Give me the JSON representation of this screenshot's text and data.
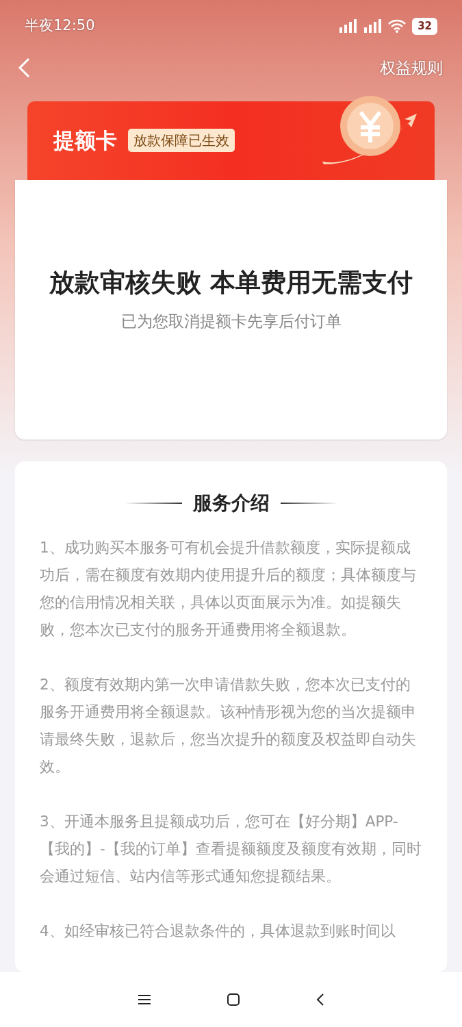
{
  "status_bar": {
    "time": "半夜12:50",
    "battery": "32"
  },
  "header": {
    "rules_link": "权益规则"
  },
  "banner": {
    "title": "提额卡",
    "badge": "放款保障已生效"
  },
  "result": {
    "title": "放款审核失败 本单费用无需支付",
    "subtitle": "已为您取消提额卡先享后付订单"
  },
  "service": {
    "title": "服务介绍",
    "paragraphs": [
      "1、成功购买本服务可有机会提升借款额度，实际提额成功后，需在额度有效期内使用提升后的额度；具体额度与您的信用情况相关联，具体以页面展示为准。如提额失败，您本次已支付的服务开通费用将全额退款。",
      "2、额度有效期内第一次申请借款失败，您本次已支付的服务开通费用将全额退款。该种情形视为您的当次提额申请最终失败，退款后，您当次提升的额度及权益即自动失效。",
      "3、开通本服务且提额成功后，您可在【好分期】APP-【我的】-【我的订单】查看提额额度及额度有效期，同时会通过短信、站内信等形式通知您提额结果。",
      "4、如经审核已符合退款条件的，具体退款到账时间以"
    ]
  }
}
